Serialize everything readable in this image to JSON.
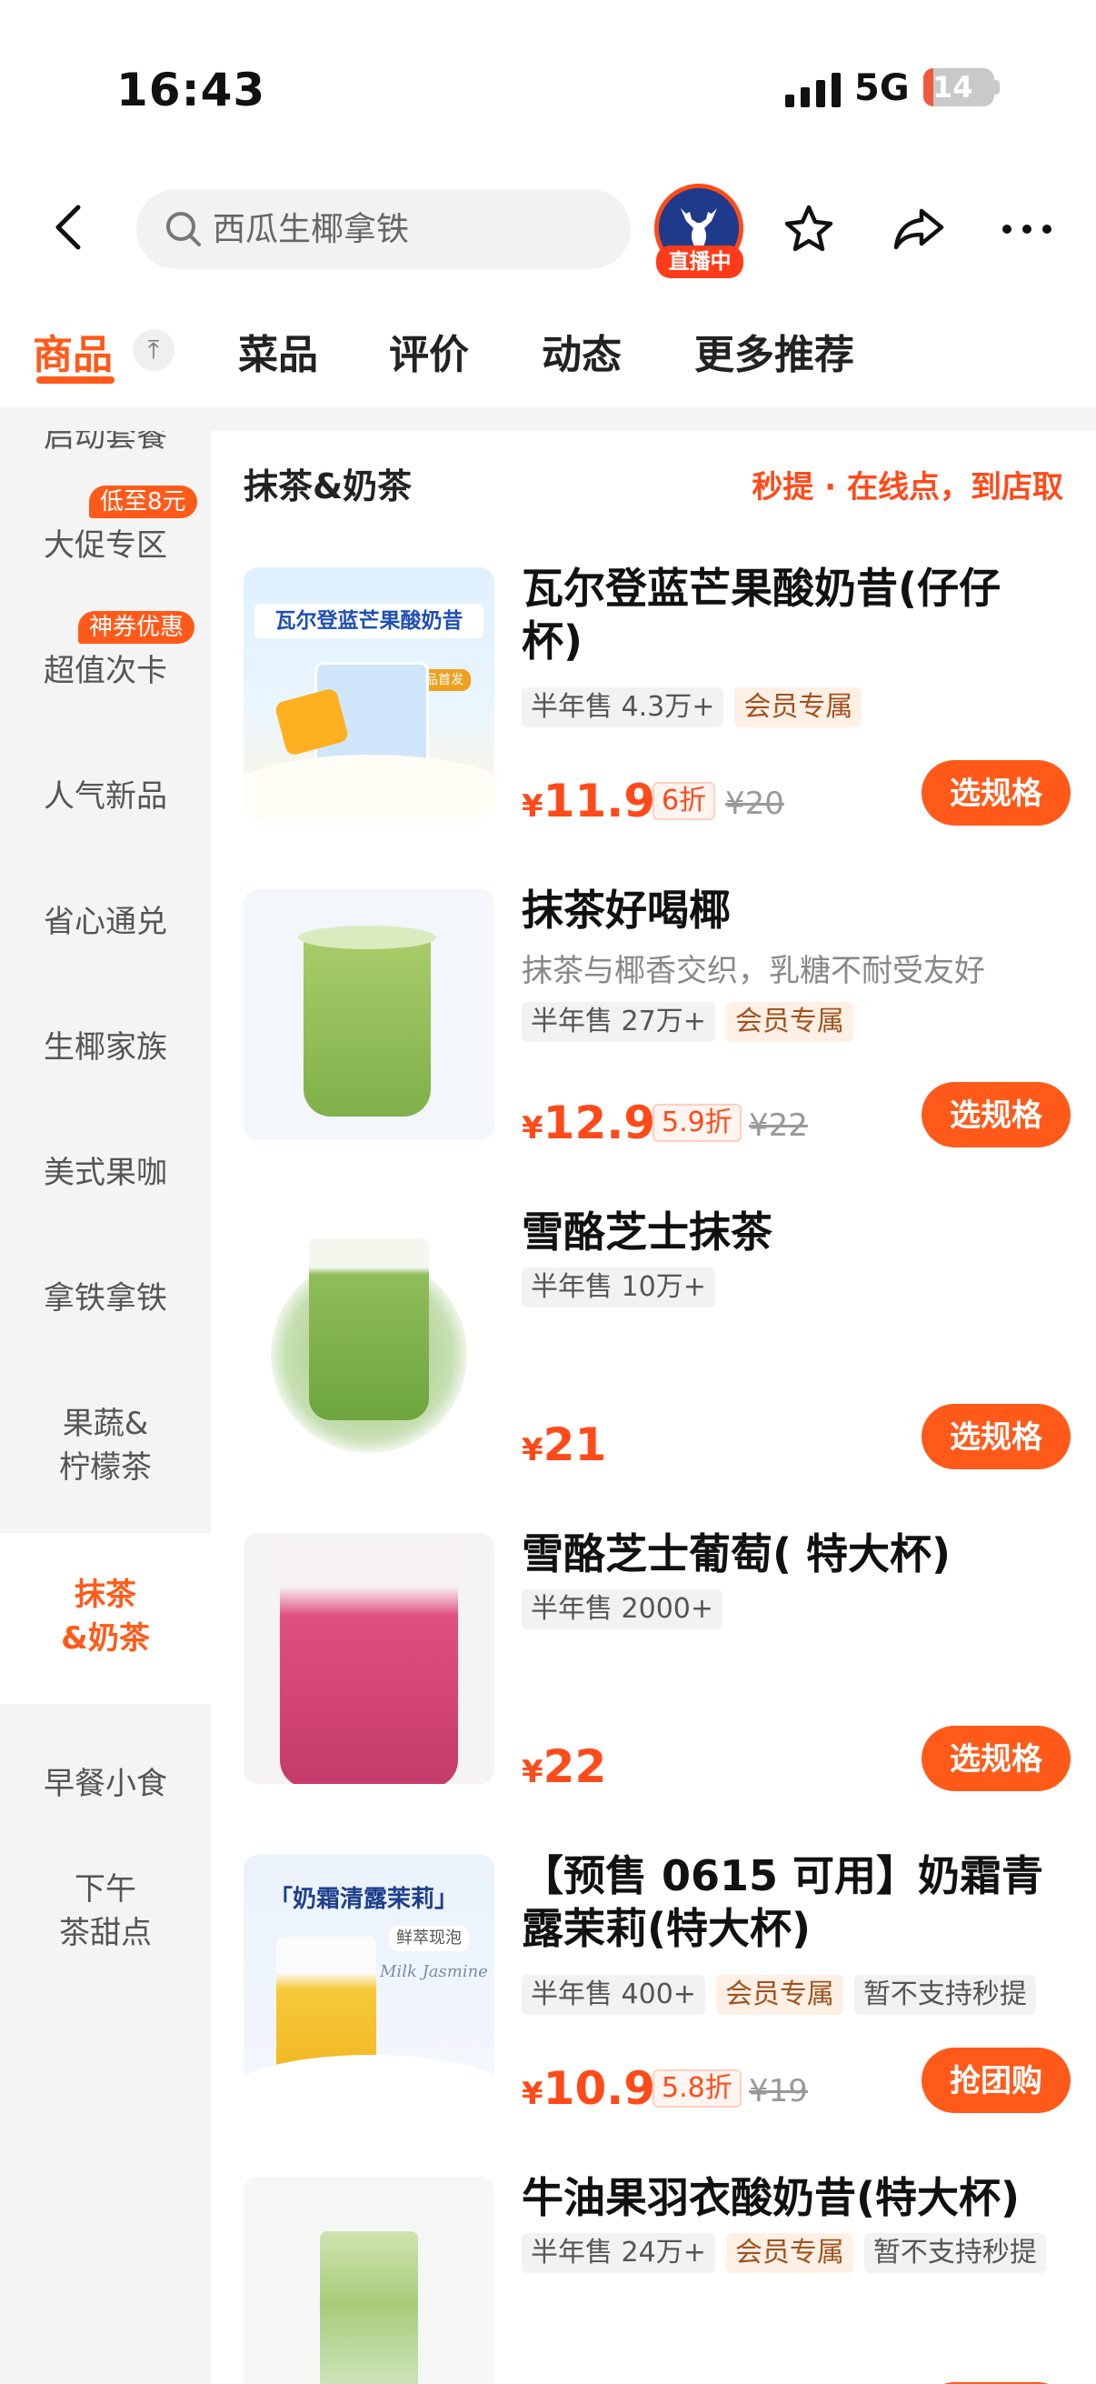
{
  "status_bar": {
    "time": "16:43",
    "network": "5G",
    "battery": "14",
    "battery_level": 0.14
  },
  "header": {
    "search_placeholder": "西瓜生椰拿铁",
    "live_badge": "直播中"
  },
  "tabs": [
    {
      "label": "商品",
      "active": true
    },
    {
      "label": "菜品"
    },
    {
      "label": "评价"
    },
    {
      "label": "动态"
    },
    {
      "label": "更多推荐"
    }
  ],
  "top_button": "⤒",
  "sidebar": {
    "items": [
      {
        "label": "启动套餐"
      },
      {
        "label": "大促专区",
        "tag": "低至8元"
      },
      {
        "label": "超值次卡",
        "tag": "神券优惠"
      },
      {
        "label": "人气新品"
      },
      {
        "label": "省心通兑"
      },
      {
        "label": "生椰家族"
      },
      {
        "label": "美式果咖"
      },
      {
        "label": "拿铁拿铁"
      },
      {
        "label": "果蔬&",
        "label2": "柠檬茶"
      },
      {
        "label": "抹茶",
        "label2": "&奶茶",
        "active": true
      },
      {
        "label": "早餐小食"
      },
      {
        "label": "下午",
        "label2": "茶甜点"
      }
    ]
  },
  "section": {
    "title": "抹茶&奶茶",
    "note": "秒提 · 在线点，到店取"
  },
  "products": [
    {
      "name": "瓦尔登蓝芒果酸奶昔(仔仔杯)",
      "sales": "半年售 4.3万+",
      "member": "会员专属",
      "currency": "¥",
      "price": "11.9",
      "discount": "6折",
      "original": "¥20",
      "button": "选规格",
      "thumb_title": "瓦尔登蓝芒果酸奶昔",
      "thumb_tag": "新品首发"
    },
    {
      "name": "抹茶好喝椰",
      "desc": "抹茶与椰香交织，乳糖不耐受友好",
      "sales": "半年售 27万+",
      "member": "会员专属",
      "currency": "¥",
      "price": "12.9",
      "discount": "5.9折",
      "original": "¥22",
      "button": "选规格"
    },
    {
      "name": "雪酪芝士抹茶",
      "sales": "半年售 10万+",
      "currency": "¥",
      "price": "21",
      "button": "选规格"
    },
    {
      "name": "雪酪芝士葡萄( 特大杯)",
      "sales": "半年售 2000+",
      "currency": "¥",
      "price": "22",
      "button": "选规格"
    },
    {
      "name": "【预售 0615 可用】奶霜青露茉莉(特大杯)",
      "sales": "半年售 400+",
      "member": "会员专属",
      "extra_tag": "暂不支持秒提",
      "currency": "¥",
      "price": "10.9",
      "discount": "5.8折",
      "original": "¥19",
      "button": "抢团购",
      "thumb_title": "「奶霜清露茉莉」",
      "thumb_tag": "鲜萃现泡",
      "thumb_script": "Milk Jasmine"
    },
    {
      "name": "牛油果羽衣酸奶昔(特大杯)",
      "sales": "半年售 24万+",
      "member": "会员专属",
      "extra_tag": "暂不支持秒提"
    }
  ]
}
